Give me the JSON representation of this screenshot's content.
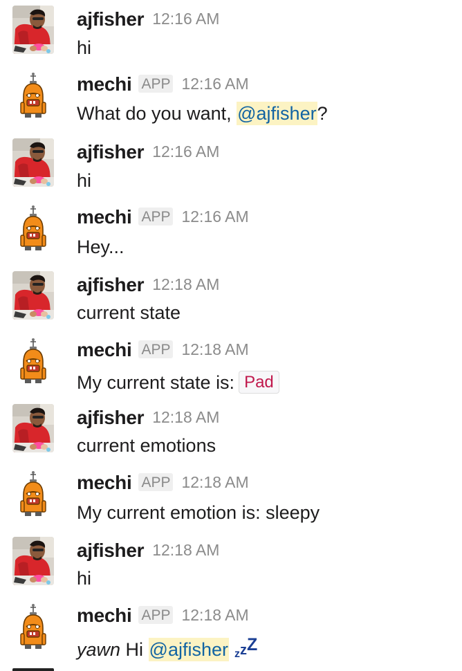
{
  "colors": {
    "mention_text": "#1264a3",
    "mention_bg": "#fcf3c3",
    "code_text": "#c0184c",
    "timestamp": "#8b8b8b"
  },
  "messages": [
    {
      "user": "ajfisher",
      "time": "12:16 AM",
      "text": "hi",
      "avatar": "ajfisher-avatar"
    },
    {
      "user": "mechi",
      "badge": "APP",
      "time": "12:16 AM",
      "text_before": "What do you want, ",
      "mention": "@ajfisher",
      "text_after": "?",
      "avatar": "robot-avatar"
    },
    {
      "user": "ajfisher",
      "time": "12:16 AM",
      "text": "hi",
      "avatar": "ajfisher-avatar"
    },
    {
      "user": "mechi",
      "badge": "APP",
      "time": "12:16 AM",
      "text": "Hey...",
      "avatar": "robot-avatar"
    },
    {
      "user": "ajfisher",
      "time": "12:18 AM",
      "text": "current state",
      "avatar": "ajfisher-avatar"
    },
    {
      "user": "mechi",
      "badge": "APP",
      "time": "12:18 AM",
      "text": "My current state is:",
      "code": "Pad",
      "avatar": "robot-avatar"
    },
    {
      "user": "ajfisher",
      "time": "12:18 AM",
      "text": "current emotions",
      "avatar": "ajfisher-avatar"
    },
    {
      "user": "mechi",
      "badge": "APP",
      "time": "12:18 AM",
      "text": "My current emotion is: sleepy",
      "avatar": "robot-avatar"
    },
    {
      "user": "ajfisher",
      "time": "12:18 AM",
      "text": "hi",
      "avatar": "ajfisher-avatar"
    },
    {
      "user": "mechi",
      "badge": "APP",
      "time": "12:18 AM",
      "italic": "yawn",
      "text_before": " Hi ",
      "mention": "@ajfisher",
      "emoji": "zzz-emoji",
      "avatar": "robot-avatar"
    }
  ]
}
